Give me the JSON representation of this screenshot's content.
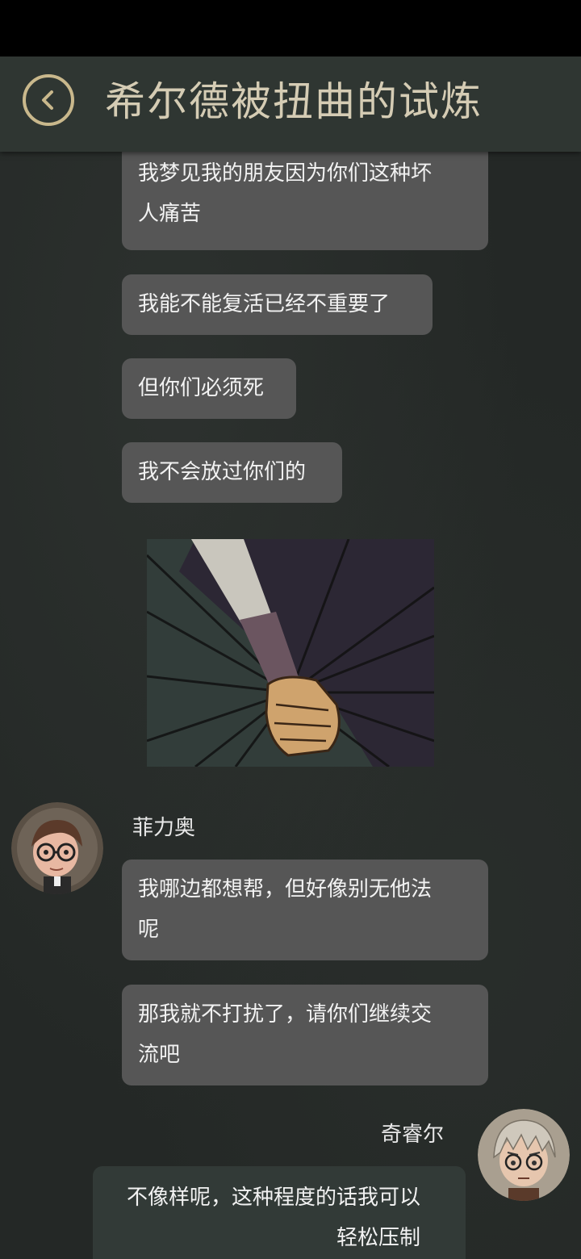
{
  "header": {
    "title": "希尔德被扭曲的试炼"
  },
  "messages": [
    {
      "sender": "",
      "text": "我梦见我的朋友因为你们这种坏\n人痛苦"
    },
    {
      "sender": "",
      "text": "我能不能复活已经不重要了"
    },
    {
      "sender": "",
      "text": "但你们必须死"
    },
    {
      "sender": "",
      "text": "我不会放过你们的"
    },
    {
      "type": "image",
      "content": "comic-panel-hand-gripping-sword-hilt"
    },
    {
      "sender": "菲力奥",
      "text": "我哪边都想帮，但好像别无他法\n呢"
    },
    {
      "sender": "",
      "text": "那我就不打扰了，请你们继续交\n流吧"
    },
    {
      "sender": "奇睿尔",
      "text": "不像样呢，这种程度的话我可以\n轻松压制"
    }
  ],
  "colors": {
    "background": "#242826",
    "header": "#2f3632",
    "accent_gold": "#c9b88c",
    "bubble_left": "#565656",
    "bubble_right": "#323a37"
  }
}
